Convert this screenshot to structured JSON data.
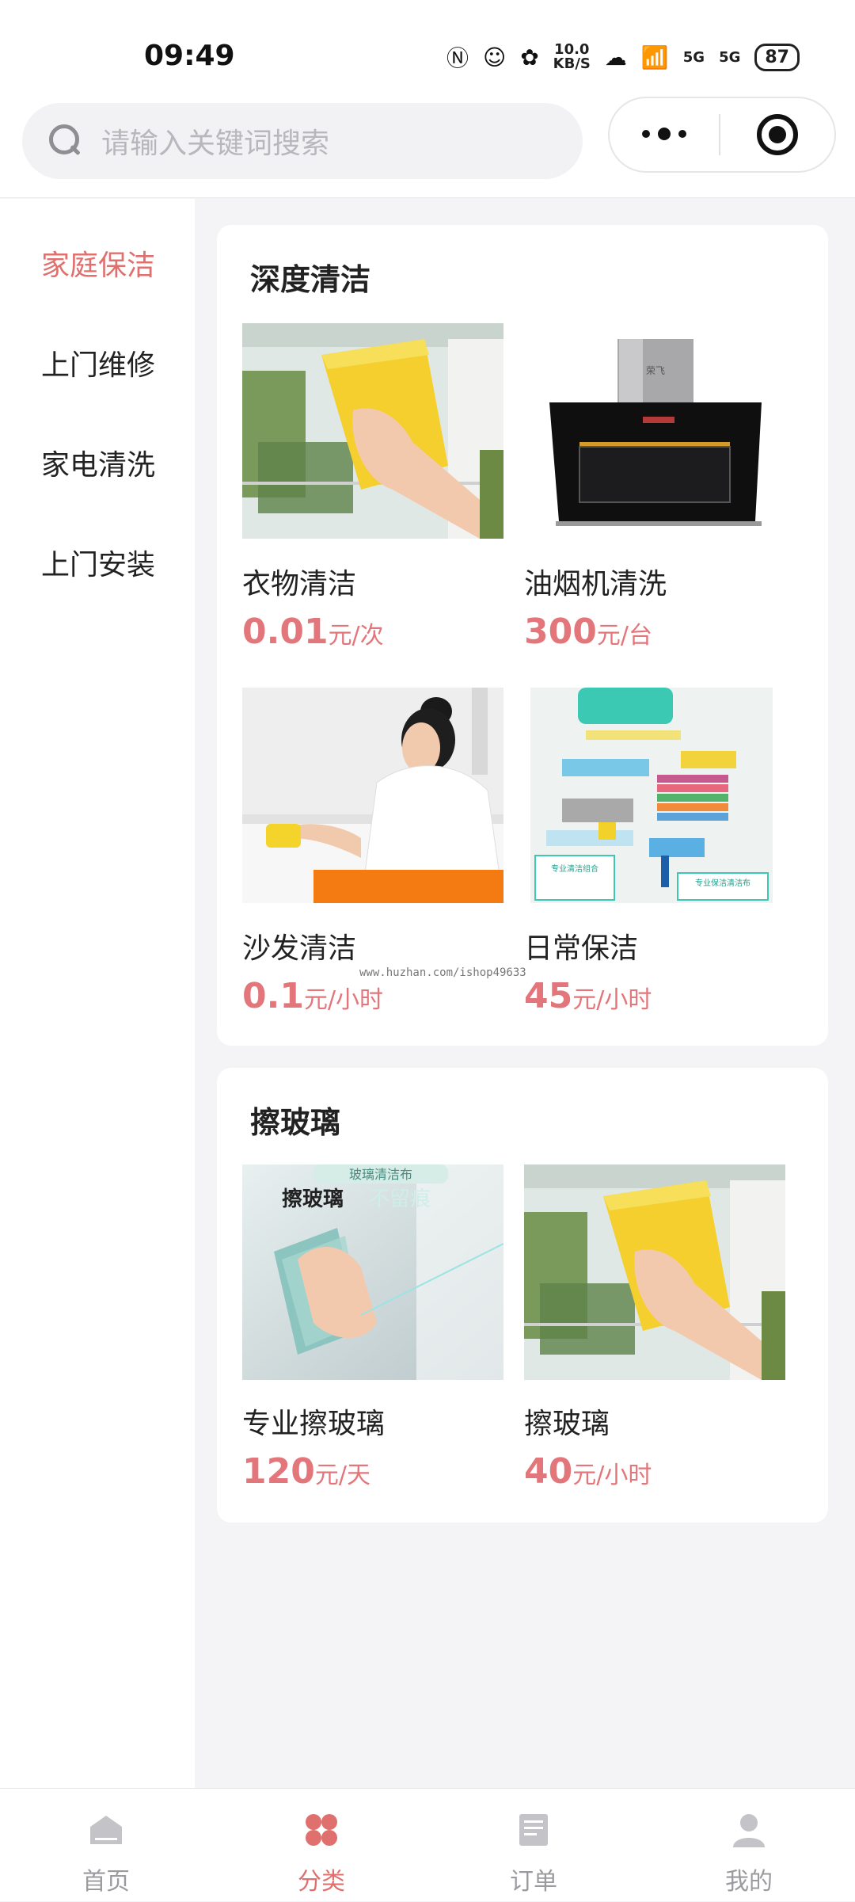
{
  "status_bar": {
    "time": "09:49",
    "speed": "10.0",
    "speed_unit": "KB/S",
    "signal_1": "5G",
    "signal_2": "5G",
    "battery": "87"
  },
  "search": {
    "placeholder": "请输入关键词搜索"
  },
  "sidebar": {
    "items": [
      {
        "label": "家庭保洁",
        "active": true
      },
      {
        "label": "上门维修",
        "active": false
      },
      {
        "label": "家电清洗",
        "active": false
      },
      {
        "label": "上门安装",
        "active": false
      }
    ]
  },
  "sections": [
    {
      "title": "深度清洁",
      "items": [
        {
          "name": "衣物清洁",
          "price": "0.01",
          "unit": "元/次"
        },
        {
          "name": "油烟机清洗",
          "price": "300",
          "unit": "元/台"
        },
        {
          "name": "沙发清洁",
          "price": "0.1",
          "unit": "元/小时"
        },
        {
          "name": "日常保洁",
          "price": "45",
          "unit": "元/小时"
        }
      ]
    },
    {
      "title": "擦玻璃",
      "items": [
        {
          "name": "专业擦玻璃",
          "price": "120",
          "unit": "元/天"
        },
        {
          "name": "擦玻璃",
          "price": "40",
          "unit": "元/小时"
        }
      ]
    }
  ],
  "image_text": {
    "glass_banner": "玻璃清洁布",
    "glass_title": "擦玻璃",
    "glass_slogan": "不留痕",
    "brand": "荣飞",
    "tool_card_1": "专业清洁组合",
    "tool_card_2": "专业保洁清洁布"
  },
  "watermark": "www.huzhan.com/ishop49633",
  "tabs": [
    {
      "label": "首页",
      "active": false
    },
    {
      "label": "分类",
      "active": true
    },
    {
      "label": "订单",
      "active": false
    },
    {
      "label": "我的",
      "active": false
    }
  ],
  "colors": {
    "accent": "#e0706e",
    "price": "#e2767a",
    "inactive_tab": "#c4c4c8"
  }
}
